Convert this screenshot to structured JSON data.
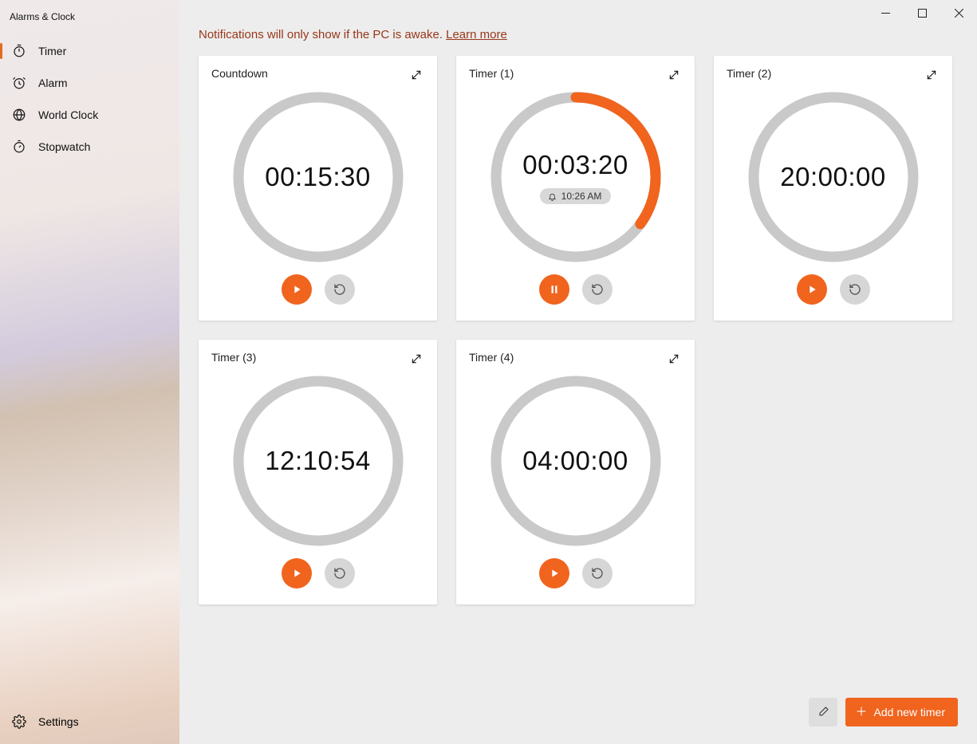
{
  "app_title": "Alarms & Clock",
  "nav": {
    "items": [
      {
        "label": "Timer",
        "active": true
      },
      {
        "label": "Alarm",
        "active": false
      },
      {
        "label": "World Clock",
        "active": false
      },
      {
        "label": "Stopwatch",
        "active": false
      }
    ],
    "settings_label": "Settings"
  },
  "notification": {
    "text": "Notifications will only show if the PC is awake. ",
    "link_label": "Learn more"
  },
  "timers": [
    {
      "title": "Countdown",
      "time": "00:15:30",
      "progress": 0.0,
      "running": false,
      "bell_time": null
    },
    {
      "title": "Timer (1)",
      "time": "00:03:20",
      "progress": 0.35,
      "running": true,
      "bell_time": "10:26 AM"
    },
    {
      "title": "Timer (2)",
      "time": "20:00:00",
      "progress": 0.0,
      "running": false,
      "bell_time": null
    },
    {
      "title": "Timer (3)",
      "time": "12:10:54",
      "progress": 0.0,
      "running": false,
      "bell_time": null
    },
    {
      "title": "Timer (4)",
      "time": "04:00:00",
      "progress": 0.0,
      "running": false,
      "bell_time": null
    }
  ],
  "bottom_bar": {
    "add_label": "Add new timer"
  },
  "colors": {
    "accent": "#f0641e",
    "ring_gray": "#c9c9c9",
    "warning_text": "#98371a"
  }
}
